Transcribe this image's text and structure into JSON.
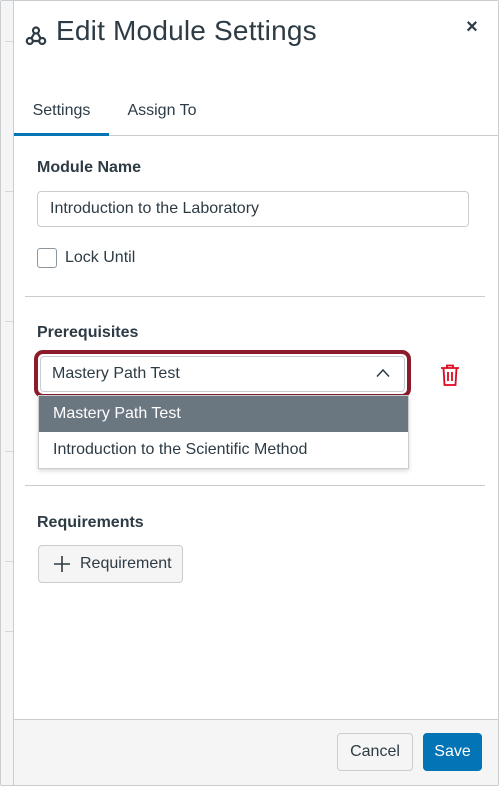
{
  "dialog": {
    "title": "Edit Module Settings",
    "close_label": "×"
  },
  "tabs": [
    {
      "label": "Settings",
      "active": true
    },
    {
      "label": "Assign To",
      "active": false
    }
  ],
  "settings": {
    "module_name_label": "Module Name",
    "module_name_value": "Introduction to the Laboratory",
    "lock_until_label": "Lock Until",
    "lock_until_checked": false,
    "prerequisites_label": "Prerequisites",
    "prerequisite_selected": "Mastery Path Test",
    "prerequisite_options": [
      "Mastery Path Test",
      "Introduction to the Scientific Method"
    ],
    "requirements_label": "Requirements",
    "add_requirement_label": "Requirement"
  },
  "footer": {
    "cancel_label": "Cancel",
    "save_label": "Save"
  },
  "colors": {
    "primary": "#0374b5",
    "highlight_outline": "#8b1a2b",
    "delete_icon": "#e0061f",
    "option_highlight": "#6b7780"
  },
  "icons": [
    "module-icon",
    "close-icon",
    "chevron-up-icon",
    "trash-icon",
    "plus-icon"
  ]
}
